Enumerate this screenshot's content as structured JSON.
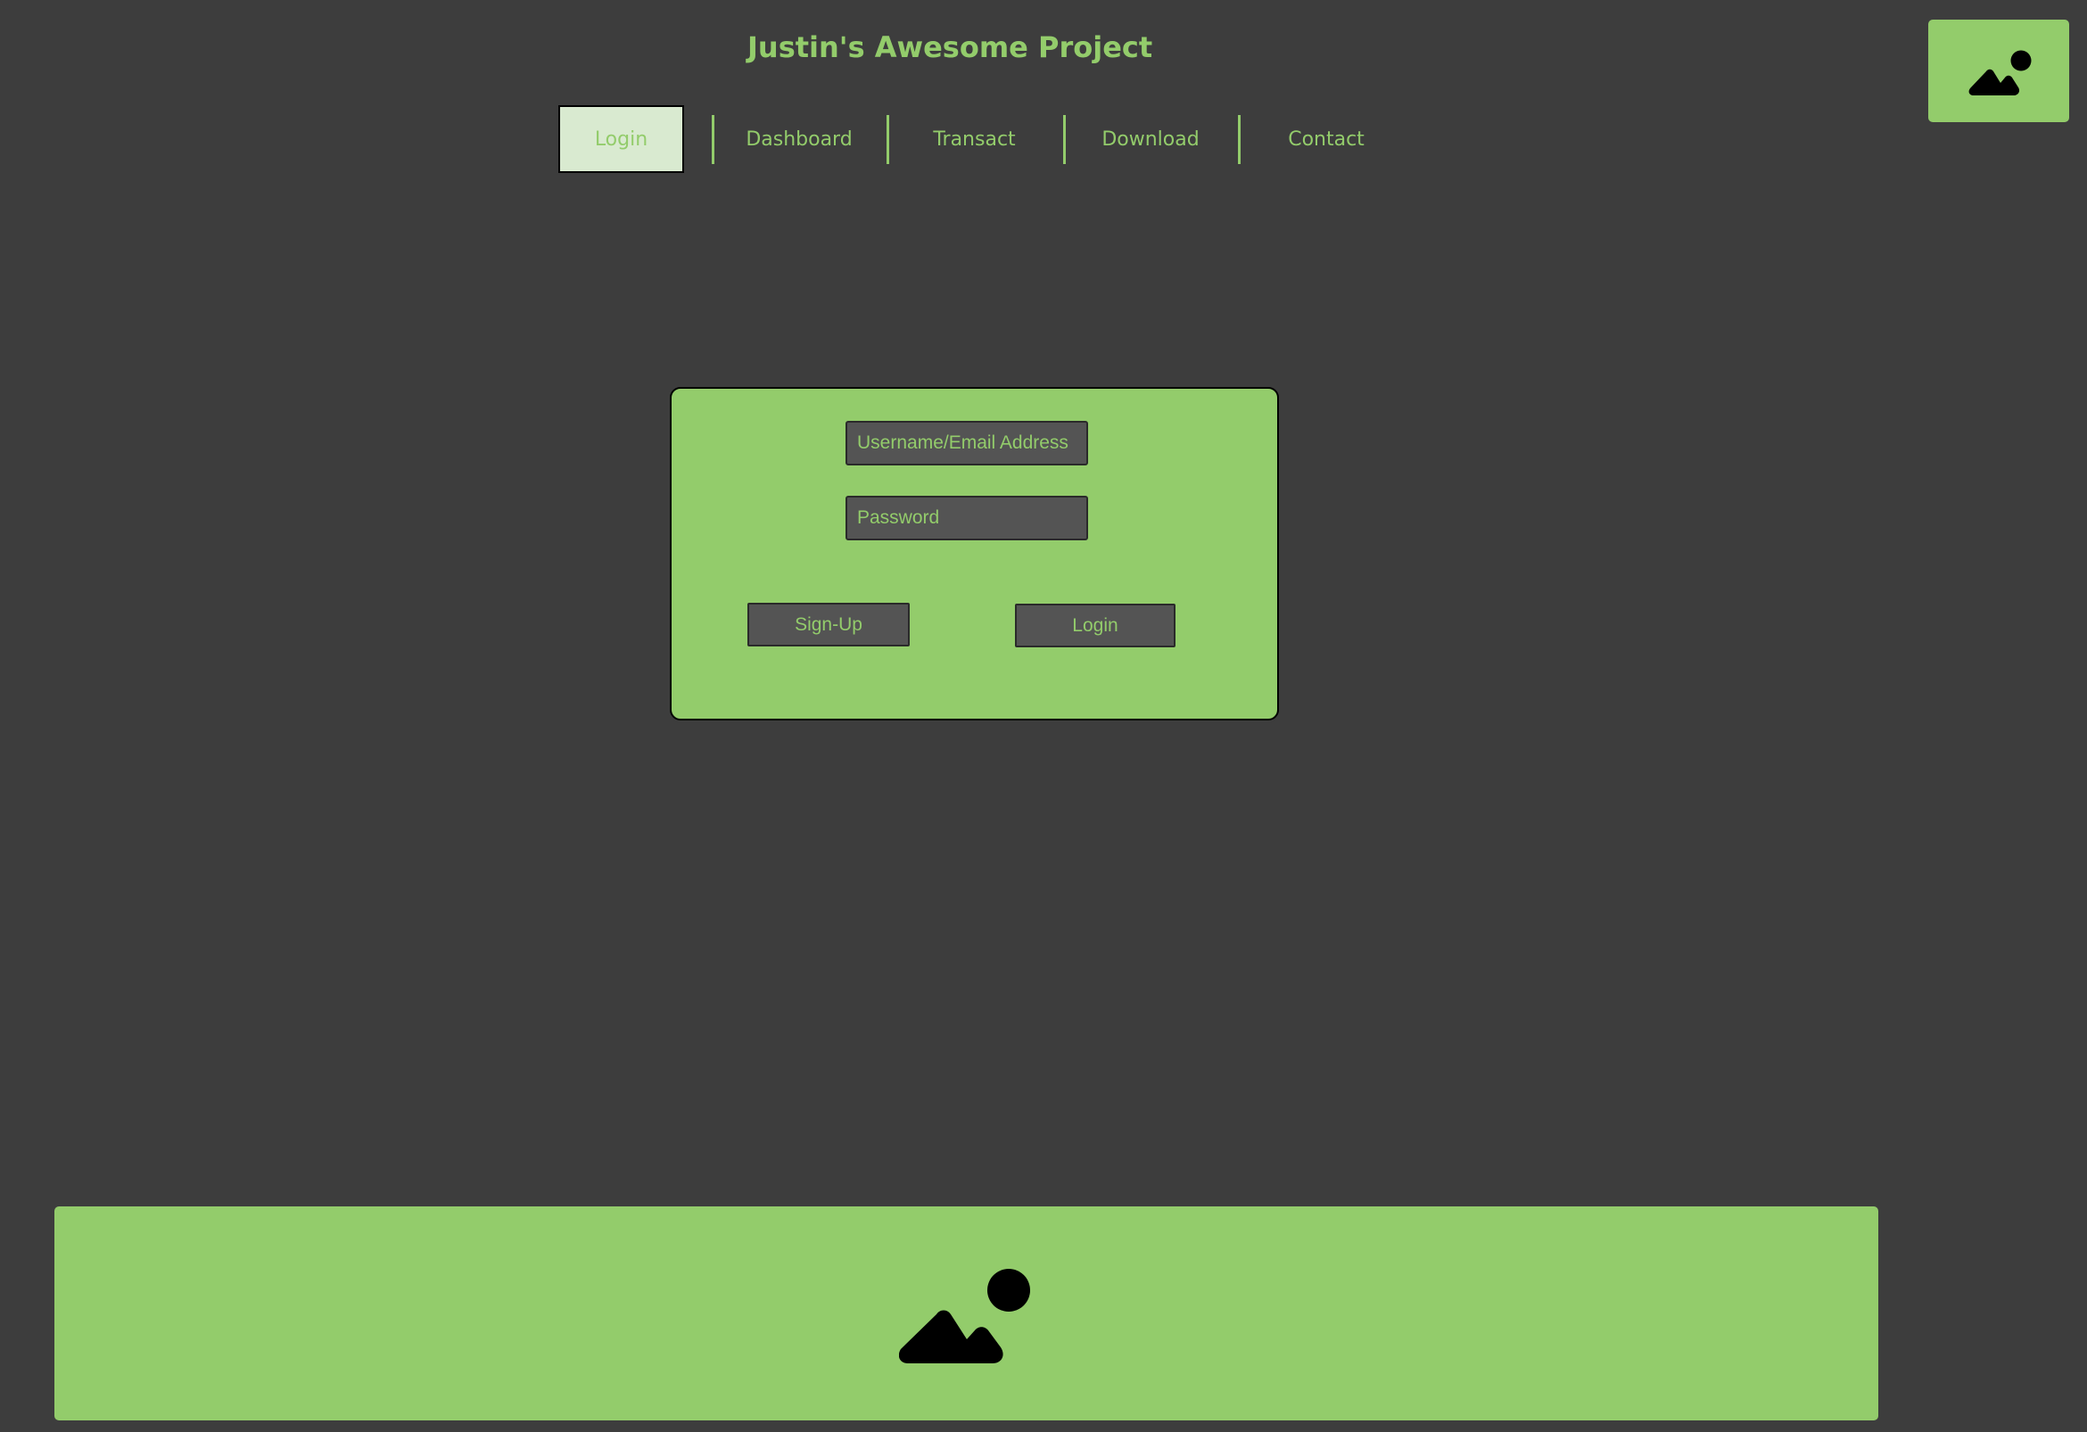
{
  "header": {
    "title": "Justin's Awesome Project",
    "logo_icon": "image-placeholder-icon"
  },
  "nav": {
    "items": [
      {
        "label": "Login",
        "active": true
      },
      {
        "label": "Dashboard",
        "active": false
      },
      {
        "label": "Transact",
        "active": false
      },
      {
        "label": "Download",
        "active": false
      },
      {
        "label": "Contact",
        "active": false
      }
    ]
  },
  "login_form": {
    "username_placeholder": "Username/Email Address",
    "username_value": "",
    "password_placeholder": "Password",
    "password_value": "",
    "signup_label": "Sign-Up",
    "login_label": "Login"
  },
  "footer": {
    "banner_icon": "image-placeholder-icon"
  },
  "colors": {
    "background": "#3d3d3d",
    "accent_green": "#93cc6b",
    "active_tab_bg": "#d9ead0",
    "input_bg": "#545454"
  }
}
